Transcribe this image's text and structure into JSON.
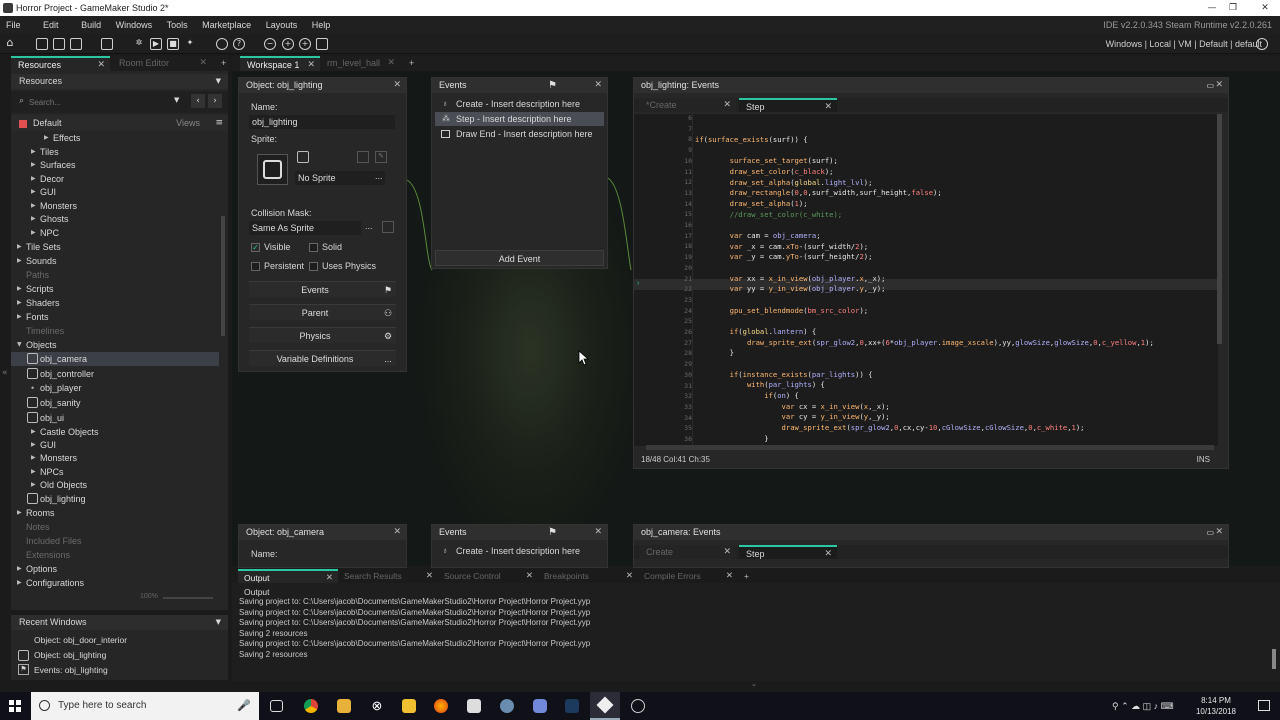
{
  "window": {
    "title": "Horror Project - GameMaker Studio 2*",
    "min": "—",
    "max": "❐",
    "close": "✕"
  },
  "menu": {
    "items": [
      "File",
      "Edit",
      "Build",
      "Windows",
      "Tools",
      "Marketplace",
      "Layouts",
      "Help"
    ],
    "version": "IDE v2.2.0.343 Steam Runtime v2.2.0.261"
  },
  "toolbar": {
    "target": "Windows | Local | VM | Default | default"
  },
  "resources": {
    "tab_resources": "Resources",
    "tab_room_editor": "Room Editor",
    "header": "Resources",
    "search_placeholder": "Search...",
    "group": "Default",
    "views": "Views",
    "tree": [
      "Effects",
      "Tiles",
      "Surfaces",
      "Decor",
      "GUI",
      "Monsters",
      "Ghosts",
      "NPC",
      "Tile Sets",
      "Sounds",
      "Paths",
      "Scripts",
      "Shaders",
      "Fonts",
      "Timelines",
      "Objects",
      "obj_camera",
      "obj_controller",
      "obj_player",
      "obj_sanity",
      "obj_ui",
      "Castle Objects",
      "GUI",
      "Monsters",
      "NPCs",
      "Old Objects",
      "obj_lighting",
      "Rooms",
      "Notes",
      "Included Files",
      "Extensions",
      "Options",
      "Configurations"
    ],
    "zoom": "100%"
  },
  "recent": {
    "header": "Recent Windows",
    "items": [
      "Object: obj_door_interior",
      "Object: obj_lighting",
      "Events: obj_lighting"
    ]
  },
  "workspace": {
    "tab1": "Workspace 1",
    "tab2": "rm_level_hall",
    "add": "+"
  },
  "objwin": {
    "title": "Object: obj_lighting",
    "name_label": "Name:",
    "name_value": "obj_lighting",
    "sprite_label": "Sprite:",
    "sprite_value": "No Sprite",
    "mask_label": "Collision Mask:",
    "mask_value": "Same As Sprite",
    "visible": "Visible",
    "solid": "Solid",
    "persistent": "Persistent",
    "physics_chk": "Uses Physics",
    "btn_events": "Events",
    "btn_parent": "Parent",
    "btn_physics": "Physics",
    "btn_vars": "Variable Definitions",
    "more": "..."
  },
  "eventswin": {
    "title": "Events",
    "items": [
      "Create - Insert description here",
      "Step - Insert description here",
      "Draw End - Insert description here"
    ],
    "add": "Add Event"
  },
  "codewin": {
    "title": "obj_lighting: Events",
    "tab_create": "*Create",
    "tab_step": "Step",
    "status": "18/48 Col:41 Ch:35",
    "mode": "INS",
    "line_numbers": [
      "6",
      "7",
      "8",
      "9",
      "10",
      "11",
      "12",
      "13",
      "14",
      "15",
      "16",
      "17",
      "18",
      "19",
      "20",
      "21",
      "22",
      "23",
      "24",
      "25",
      "26",
      "27",
      "28",
      "29",
      "30",
      "31",
      "32",
      "33",
      "34",
      "35",
      "36"
    ]
  },
  "objwin2": {
    "title": "Object: obj_camera",
    "name_label": "Name:"
  },
  "eventswin2": {
    "title": "Events",
    "item": "Create - Insert description here"
  },
  "codewin2": {
    "title": "obj_camera: Events",
    "tab_create": "Create",
    "tab_step": "Step"
  },
  "output": {
    "tabs": [
      "Output",
      "Search Results",
      "Source Control",
      "Breakpoints",
      "Compile Errors"
    ],
    "header": "Output",
    "lines": [
      "Saving project to: C:\\Users\\jacob\\Documents\\GameMakerStudio2\\Horror Project\\Horror Project.yyp",
      "Saving project to: C:\\Users\\jacob\\Documents\\GameMakerStudio2\\Horror Project\\Horror Project.yyp",
      "Saving project to: C:\\Users\\jacob\\Documents\\GameMakerStudio2\\Horror Project\\Horror Project.yyp",
      "Saving 2 resources",
      "Saving project to: C:\\Users\\jacob\\Documents\\GameMakerStudio2\\Horror Project\\Horror Project.yyp",
      "Saving 2 resources"
    ]
  },
  "taskbar": {
    "search": "Type here to search",
    "time": "8:14 PM",
    "date": "10/13/2018"
  }
}
